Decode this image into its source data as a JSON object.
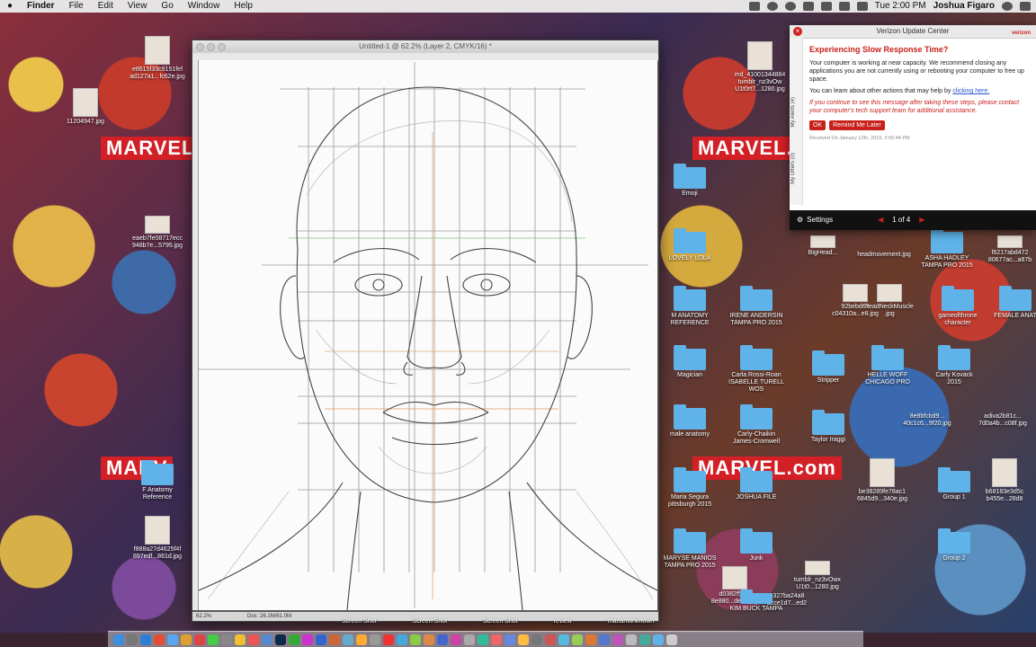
{
  "menubar": {
    "app": "Finder",
    "items": [
      "File",
      "Edit",
      "View",
      "Go",
      "Window",
      "Help"
    ],
    "time": "Tue 2:00 PM",
    "user": "Joshua Figaro"
  },
  "wallpaper": {
    "logo_text": "MARVEL.com",
    "logo_text_short": "MARV"
  },
  "photoshop": {
    "title": "Untitled-1 @ 62.2% (Layer 2, CMYK/16) *",
    "zoom": "62.2%",
    "doc_info": "Doc: 26.1M/61.0M"
  },
  "verizon": {
    "header": "Verizon Update Center",
    "logo": "verizon",
    "tab_alerts": "My Alerts (4)",
    "tab_offers": "My Offers (0)",
    "title": "Experiencing Slow Response Time?",
    "para1": "Your computer is working at near capacity. We recommend closing any applications you are not currently using or rebooting your computer to free up space.",
    "para2_prefix": "You can learn about other actions that may help by",
    "para2_link": "clicking here.",
    "para3": "If you continue to see this message after taking these steps, please contact your computer's tech support team for additional assistance.",
    "ok_label": "OK",
    "remind_label": "Remind Me Later",
    "received": "Received On January 12th, 2016, 2:00:44 PM",
    "settings_label": "Settings",
    "pager": "1 of 4"
  },
  "desktop_left": [
    {
      "label": "e8615f33c9151fef\nad127a1...fc62e.jpg"
    },
    {
      "label": "11204947.jpg"
    },
    {
      "label": "eaeb7fe08717ecc\n948b7e...5795.jpg"
    },
    {
      "label": "F Anatomy\nReference"
    },
    {
      "label": "f888a27d4625f4f\n897edf...861d.jpg"
    }
  ],
  "desktop_right": [
    {
      "label": "md_41001344884\ntumblr_nz3vOw\nU1t0rt7...1280.jpg"
    },
    {
      "label": "Emoji"
    },
    {
      "label": "LOVELY LOLA"
    },
    {
      "label": "BigHead..."
    },
    {
      "label": "ASHA HADLEY\nTAMPA PRO 2015"
    },
    {
      "label": "f6217abd472\n80677ac...a87b"
    },
    {
      "label": "M ANATOMY\nREFERENCE"
    },
    {
      "label": "IRENE ANDERSIN\nTAMPA PRO 2015"
    },
    {
      "label": "headmovement.jpg"
    },
    {
      "label": "92bebd67\nc04310a...e8.jpg"
    },
    {
      "label": "headNeckMuscle\n.jpg"
    },
    {
      "label": "gameofthrone\ncharacter"
    },
    {
      "label": "FEMALE ANAT"
    },
    {
      "label": "Carla Rossi-Roan\nISABELLE TURELL\nWOS"
    },
    {
      "label": "Stripper"
    },
    {
      "label": "HELLE WOFF\nCHICAGO PRO"
    },
    {
      "label": "Carly Kovack\n2015"
    },
    {
      "label": "Magician"
    },
    {
      "label": "Carly-Chaikin\nJames-Cromwell"
    },
    {
      "label": "Taylor Iraggi"
    },
    {
      "label": "8e8bfcbd9...\n40c1c6...9f20.jpg"
    },
    {
      "label": "adiva2b81c...\n7d0a4b...c08f.jpg"
    },
    {
      "label": "male anatomy"
    },
    {
      "label": "Maria Segura\npittsburgh 2015"
    },
    {
      "label": "JOSHUA FILE"
    },
    {
      "label": "be38289fe78ac1\n6845d9...340e.jpg"
    },
    {
      "label": "Group 1"
    },
    {
      "label": "b68183e3d5c\nb455e...28d8"
    },
    {
      "label": "MARYSE MANIOS\nTAMPA PRO 2015"
    },
    {
      "label": "Junk"
    },
    {
      "label": "Group 2"
    },
    {
      "label": "tumblr_nz3vOwx\nU1t0...1280.jpg"
    },
    {
      "label": "d0382f57...\n8e880...deeb.jpg"
    },
    {
      "label": "0327ba24a8\nbcce1d7...ed2"
    },
    {
      "label": "KIM BUCK TAMPA"
    }
  ],
  "dock_labels": [
    "Screen Shot",
    "Screen Shot",
    "Screen Shot",
    "review",
    "manamunknown"
  ]
}
